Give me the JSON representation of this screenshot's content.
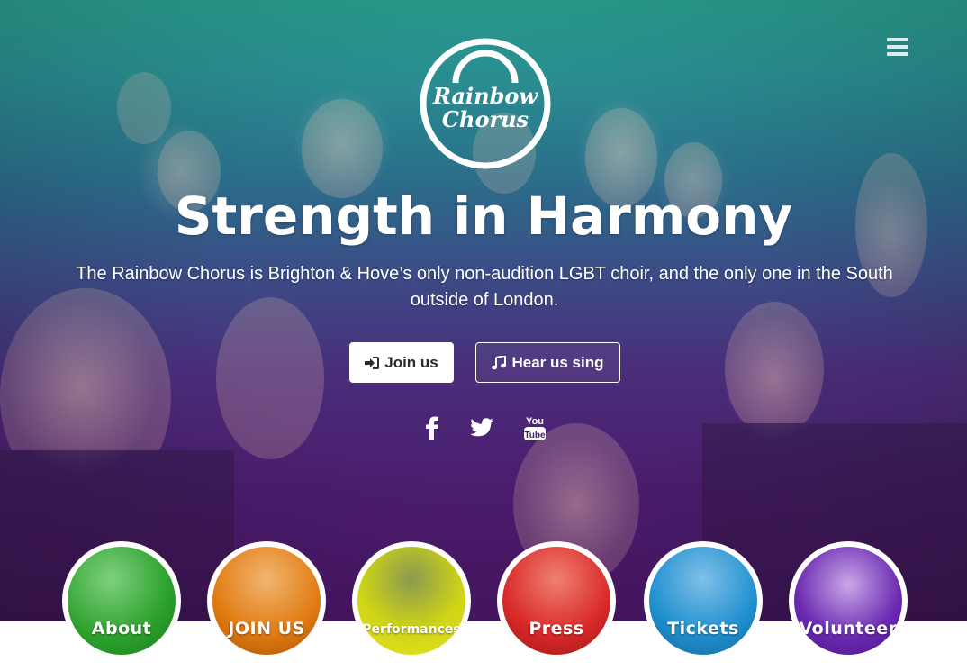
{
  "nav": {
    "menu_icon": "hamburger-menu-icon"
  },
  "logo": {
    "line1": "Rainbow",
    "line2": "Chorus"
  },
  "hero": {
    "headline": "Strength in Harmony",
    "tagline": "The Rainbow Chorus is Brighton & Hove’s only non-audition LGBT choir, and the only one in the South outside of London."
  },
  "buttons": {
    "join": {
      "label": "Join us",
      "icon": "sign-in-icon"
    },
    "hear": {
      "label": "Hear us sing",
      "icon": "music-note-icon"
    }
  },
  "social": [
    {
      "name": "facebook-icon"
    },
    {
      "name": "twitter-icon"
    },
    {
      "name": "youtube-icon",
      "text": "You Tube"
    }
  ],
  "sections": [
    {
      "label": "About",
      "color": "#2aa02a"
    },
    {
      "label": "JOIN US",
      "color": "#e07a10"
    },
    {
      "label": "Performances",
      "color": "#cfd416"
    },
    {
      "label": "Press",
      "color": "#d82828"
    },
    {
      "label": "Tickets",
      "color": "#1f8fcf"
    },
    {
      "label": "Volunteer",
      "color": "#6a28b0"
    }
  ]
}
